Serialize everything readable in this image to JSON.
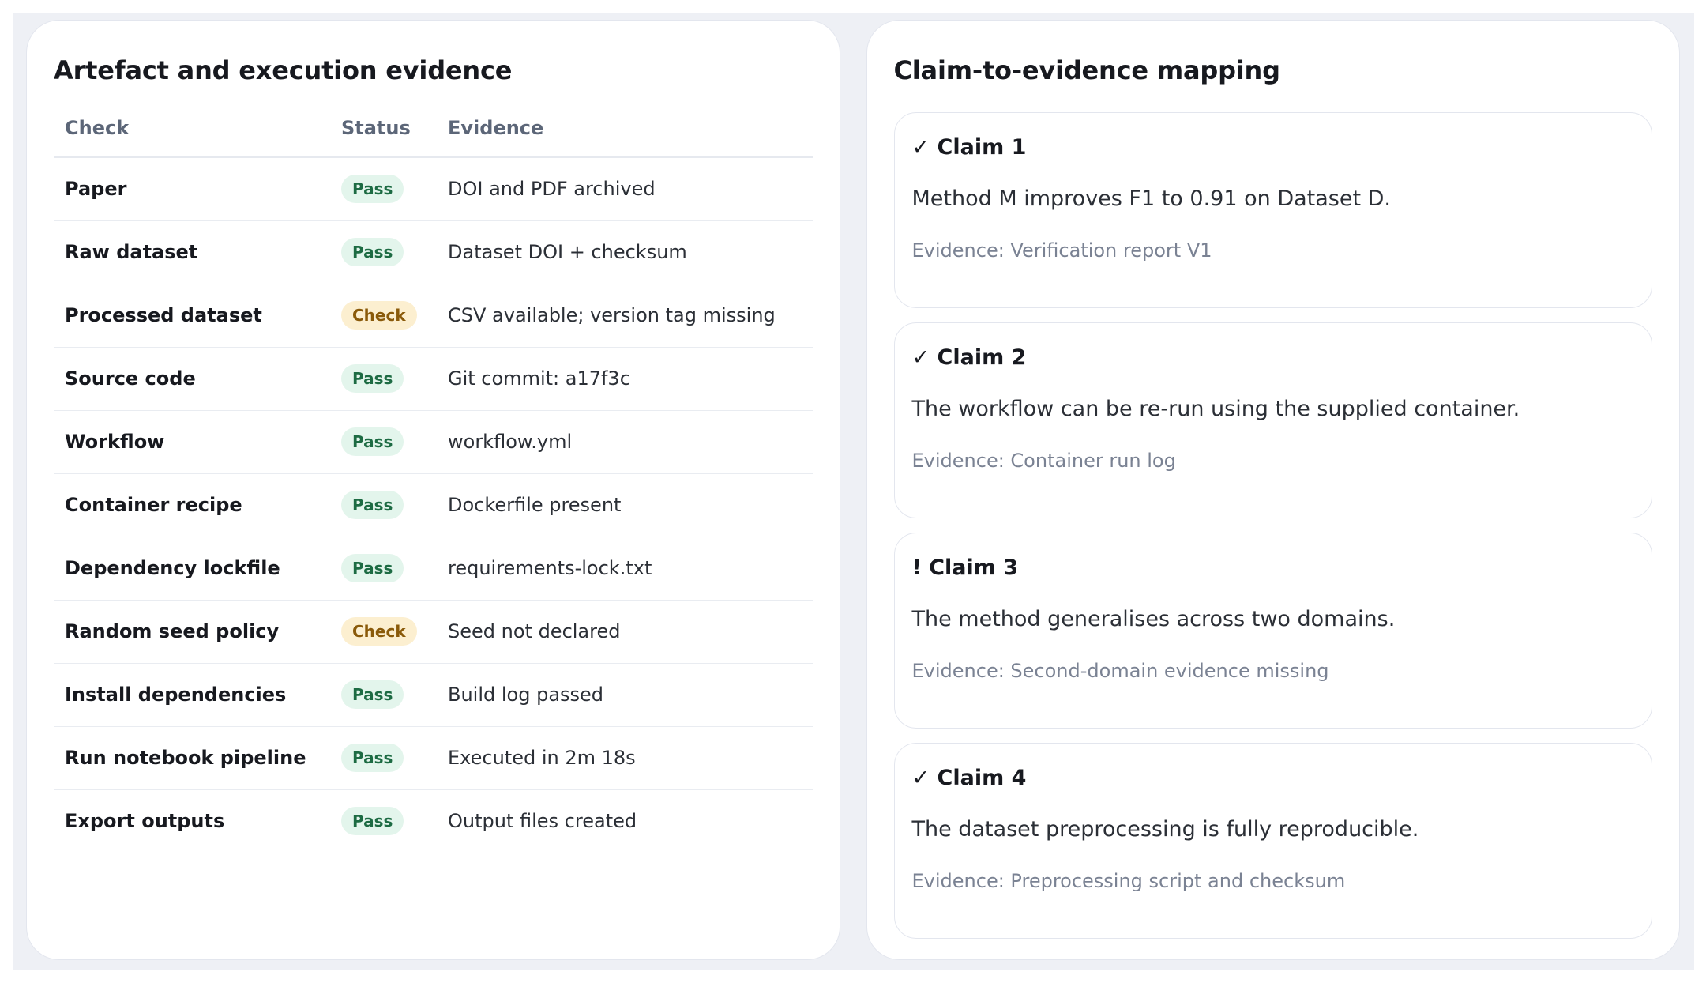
{
  "left": {
    "title": "Artefact and execution evidence",
    "headers": {
      "check": "Check",
      "status": "Status",
      "evidence": "Evidence"
    },
    "rows": [
      {
        "check": "Paper",
        "status": "Pass",
        "evidence": "DOI and PDF archived"
      },
      {
        "check": "Raw dataset",
        "status": "Pass",
        "evidence": "Dataset DOI + checksum"
      },
      {
        "check": "Processed dataset",
        "status": "Check",
        "evidence": "CSV available; version tag missing"
      },
      {
        "check": "Source code",
        "status": "Pass",
        "evidence": "Git commit: a17f3c"
      },
      {
        "check": "Workflow",
        "status": "Pass",
        "evidence": "workflow.yml"
      },
      {
        "check": "Container recipe",
        "status": "Pass",
        "evidence": "Dockerfile present"
      },
      {
        "check": "Dependency lockfile",
        "status": "Pass",
        "evidence": "requirements-lock.txt"
      },
      {
        "check": "Random seed policy",
        "status": "Check",
        "evidence": "Seed not declared"
      },
      {
        "check": "Install dependencies",
        "status": "Pass",
        "evidence": "Build log passed"
      },
      {
        "check": "Run notebook pipeline",
        "status": "Pass",
        "evidence": "Executed in 2m 18s"
      },
      {
        "check": "Export outputs",
        "status": "Pass",
        "evidence": "Output files created"
      }
    ],
    "status_colors": {
      "pass_bg": "#e3f5ec",
      "pass_fg": "#1d6b43",
      "check_bg": "#fcefd0",
      "check_fg": "#8a5a0a"
    }
  },
  "right": {
    "title": "Claim-to-evidence mapping",
    "claims": [
      {
        "title": "✓ Claim 1",
        "text": "Method M improves F1 to 0.91 on Dataset D.",
        "evidence": "Evidence: Verification report V1"
      },
      {
        "title": "✓ Claim 2",
        "text": "The workflow can be re-run using the supplied container.",
        "evidence": "Evidence: Container run log"
      },
      {
        "title": "! Claim 3",
        "text": "The method generalises across two domains.",
        "evidence": "Evidence: Second-domain evidence missing"
      },
      {
        "title": "✓ Claim 4",
        "text": "The dataset preprocessing is fully reproducible.",
        "evidence": "Evidence: Preprocessing script and checksum"
      }
    ]
  }
}
